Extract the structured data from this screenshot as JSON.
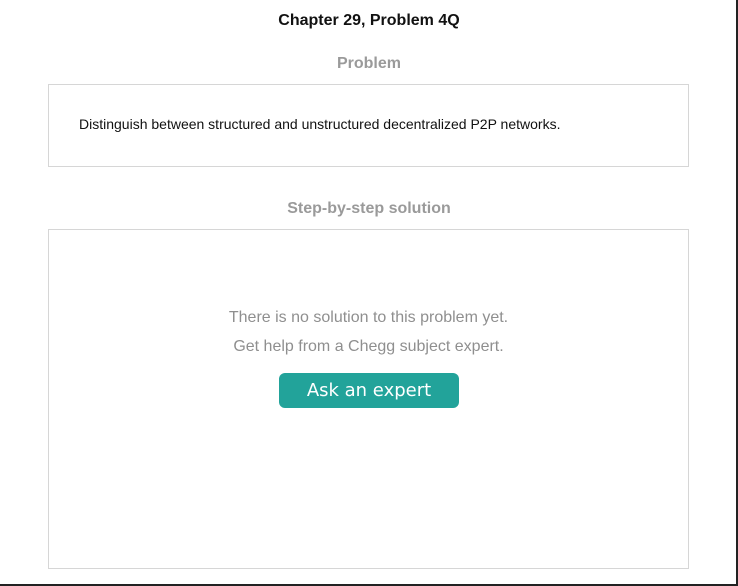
{
  "header": {
    "chapter_title": "Chapter 29, Problem 4Q"
  },
  "problem": {
    "heading": "Problem",
    "text": "Distinguish between structured and unstructured decentralized P2P networks."
  },
  "solution": {
    "heading": "Step-by-step solution",
    "empty_line1": "There is no solution to this problem yet.",
    "empty_line2": "Get help from a Chegg subject expert.",
    "ask_button_label": "Ask an expert"
  },
  "colors": {
    "accent_button": "#22a39a",
    "heading_gray": "#9a9a9a",
    "border": "#d6d6d6"
  }
}
